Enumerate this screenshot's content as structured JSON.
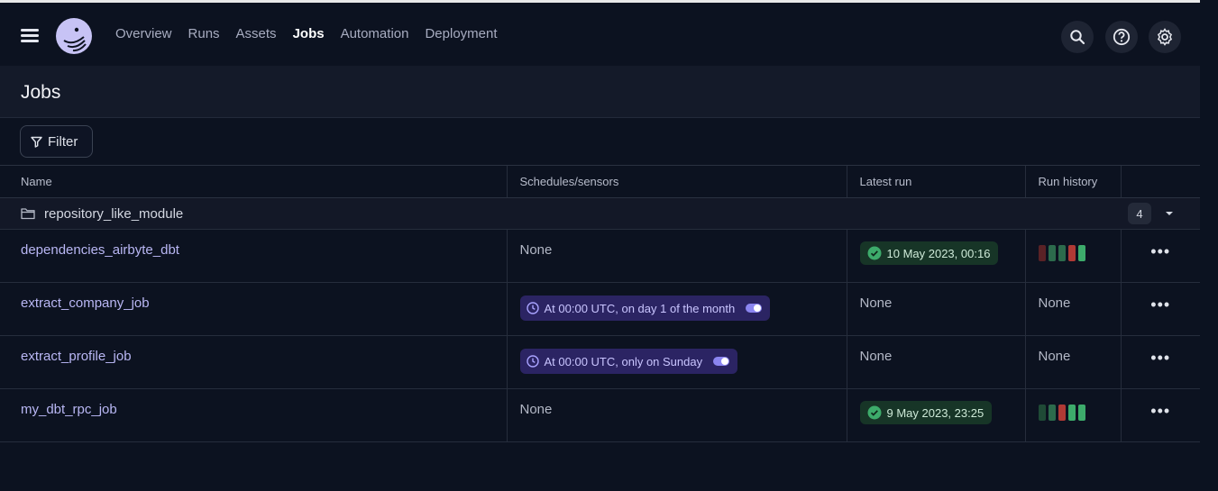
{
  "nav": {
    "items": [
      "Overview",
      "Runs",
      "Assets",
      "Jobs",
      "Automation",
      "Deployment"
    ],
    "active": "Jobs"
  },
  "page": {
    "title": "Jobs"
  },
  "filter": {
    "label": "Filter"
  },
  "table": {
    "headers": [
      "Name",
      "Schedules/sensors",
      "Latest run",
      "Run history"
    ],
    "group": {
      "name": "repository_like_module",
      "count": "4"
    },
    "rows": [
      {
        "name": "dependencies_airbyte_dbt",
        "schedule": "None",
        "schedule_active": false,
        "latest_run": "10 May 2023, 00:16",
        "latest_run_status": "success",
        "history": "bars",
        "history_colors": [
          "#5a2226",
          "#2c6b4c",
          "#2c6b4c",
          "#b03a35",
          "#3dab6b"
        ]
      },
      {
        "name": "extract_company_job",
        "schedule": "At 00:00 UTC, on day 1 of the month",
        "schedule_active": true,
        "latest_run": "None",
        "history": "None"
      },
      {
        "name": "extract_profile_job",
        "schedule": "At 00:00 UTC, only on Sunday",
        "schedule_active": true,
        "latest_run": "None",
        "history": "None"
      },
      {
        "name": "my_dbt_rpc_job",
        "schedule": "None",
        "schedule_active": false,
        "latest_run": "9 May 2023, 23:25",
        "latest_run_status": "success",
        "history": "bars",
        "history_colors": [
          "#1f4a36",
          "#2c6b4c",
          "#b03a35",
          "#3dab6b",
          "#3dab6b"
        ]
      }
    ]
  },
  "colors": {
    "accent": "#b9b7f4",
    "success": "#3dab6b",
    "failure": "#b03a35"
  },
  "icons": {
    "menu": "hamburger-icon",
    "search": "search-icon",
    "help": "help-icon",
    "settings": "gear-icon",
    "folder": "folder-icon",
    "schedule": "clock-icon"
  }
}
